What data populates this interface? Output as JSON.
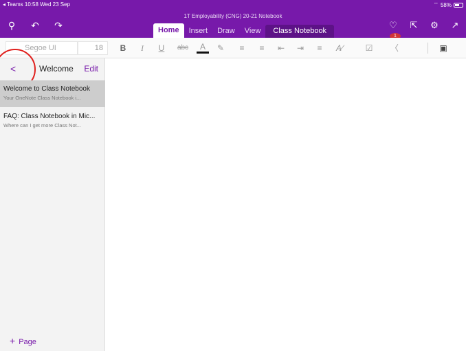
{
  "status": {
    "left": "◂ Teams  10:58  Wed 23 Sep",
    "battery": "58%",
    "battery_level": 0.58
  },
  "notebook_title": "1T Employability (CNG) 20-21 Notebook",
  "header": {
    "left_icons": [
      "search-icon",
      "undo-icon",
      "redo-icon"
    ],
    "right_icons": [
      "notification-bell-icon",
      "share-icon",
      "settings-gear-icon",
      "expand-icon"
    ],
    "notification_count": "1"
  },
  "tabs": [
    {
      "label": "Home",
      "active": true
    },
    {
      "label": "Insert"
    },
    {
      "label": "Draw"
    },
    {
      "label": "View"
    },
    {
      "label": "Class Notebook"
    }
  ],
  "toolbar": {
    "font": "Segoe UI",
    "size": "18",
    "buttons": [
      "bold",
      "italic",
      "underline",
      "strikethrough",
      "font-color",
      "highlighter",
      "bulleted-list",
      "numbered-list",
      "decrease-indent",
      "increase-indent",
      "align",
      "styles",
      "to-do-checkbox",
      "tag",
      "sticky-note"
    ],
    "labels": {
      "bold": "B",
      "italic": "I",
      "underline": "U",
      "strike": "abc",
      "fontcolor": "A"
    }
  },
  "sidebar": {
    "back": "<",
    "title": "Welcome",
    "edit": "Edit",
    "pages": [
      {
        "title": "Welcome to Class Notebook",
        "subtitle": "Your OneNote Class Notebook i...",
        "selected": true
      },
      {
        "title": "FAQ: Class Notebook in Mic...",
        "subtitle": "Where can I get more Class Not..."
      }
    ],
    "add_page": "Page"
  },
  "colors": {
    "accent": "#7719aa",
    "annotation_circle": "#e0201d"
  }
}
